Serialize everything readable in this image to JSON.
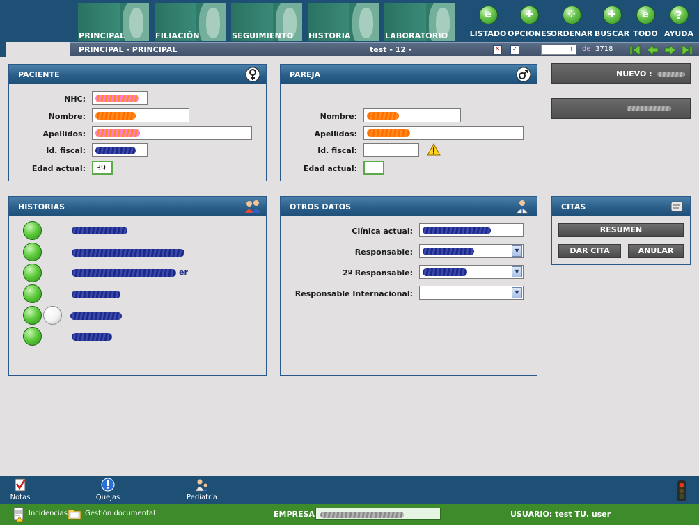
{
  "nav": {
    "tabs": [
      "PRINCIPAL",
      "FILIACIÓN",
      "SEGUIMIENTO",
      "HISTORIA",
      "LABORATORIO"
    ],
    "tools": [
      {
        "label": "LISTADO",
        "icon": "list-icon"
      },
      {
        "label": "OPCIONES",
        "icon": "options-icon"
      },
      {
        "label": "ORDENAR",
        "icon": "sort-icon"
      },
      {
        "label": "BUSCAR",
        "icon": "search-icon"
      },
      {
        "label": "TODO",
        "icon": "all-icon"
      },
      {
        "label": "AYUDA",
        "icon": "help-icon"
      }
    ]
  },
  "subbar": {
    "breadcrumb": "PRINCIPAL - PRINCIPAL",
    "record": "test - 12  -",
    "page": "1",
    "of_label": "de",
    "total": "3718"
  },
  "paciente": {
    "title": "PACIENTE",
    "nhc_label": "NHC:",
    "nombre_label": "Nombre:",
    "apellidos_label": "Apellidos:",
    "idfiscal_label": "Id. fiscal:",
    "edad_label": "Edad actual:",
    "edad_value": "39"
  },
  "pareja": {
    "title": "PAREJA",
    "nombre_label": "Nombre:",
    "apellidos_label": "Apellidos:",
    "idfiscal_label": "Id. fiscal:",
    "edad_label": "Edad actual:",
    "edad_value": ""
  },
  "right": {
    "nuevo_label": "NUEVO :"
  },
  "historias": {
    "title": "HISTORIAS",
    "items": [
      {
        "suffix": ""
      },
      {
        "suffix": ""
      },
      {
        "suffix": "er"
      },
      {
        "suffix": ""
      },
      {
        "suffix": ""
      },
      {
        "suffix": ""
      }
    ]
  },
  "otros": {
    "title": "OTROS DATOS",
    "clinica_label": "Clínica actual:",
    "responsable_label": "Responsable:",
    "responsable2_label": "2º Responsable:",
    "responsable_int_label": "Responsable Internacional:"
  },
  "citas": {
    "title": "CITAS",
    "resumen": "RESUMEN",
    "dar_cita": "DAR CITA",
    "anular": "ANULAR"
  },
  "bottom": {
    "notas": "Notas",
    "quejas": "Quejas",
    "pediatria": "Pediatría"
  },
  "status": {
    "incidencias": "Incidencias",
    "gestion": "Gestión documental",
    "empresa_label": "EMPRESA:",
    "usuario": "USUARIO: test TU. user"
  },
  "colors": {
    "header_blue": "#1e5076",
    "nav_teal": "#2f7a68",
    "status_green": "#3d8b2b",
    "redaction_orange": "#ff7a00",
    "redaction_navy": "#1d2a85"
  }
}
